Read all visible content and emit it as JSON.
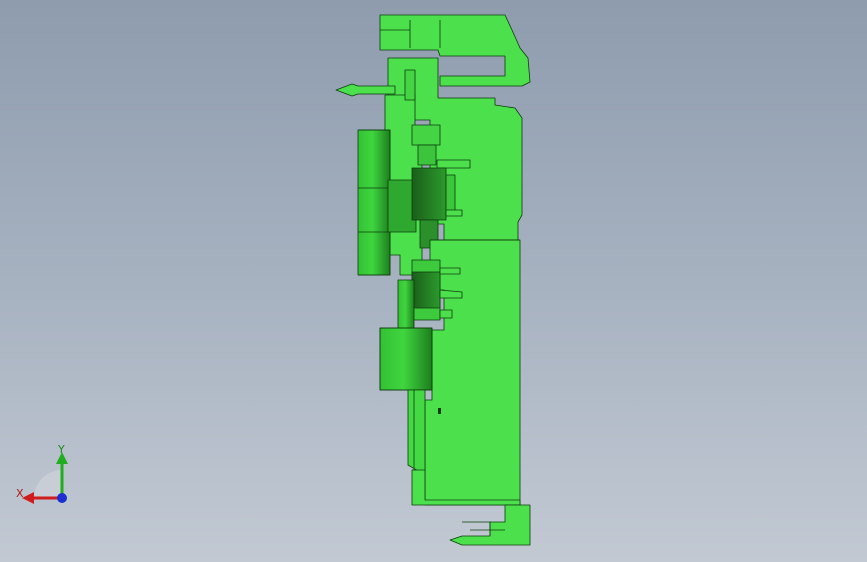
{
  "viewport": {
    "background_top": "#8e9cae",
    "background_bottom": "#c2c9d3"
  },
  "model": {
    "part_color": "#4ce04c",
    "part_shadow_color": "#1f7a1f",
    "edge_color": "#0d3d0d",
    "view": "side-view"
  },
  "triad": {
    "x_label": "X",
    "y_label": "Y",
    "x_color": "#d01c1c",
    "y_color": "#1fae1f",
    "z_color": "#1c2fd0"
  }
}
